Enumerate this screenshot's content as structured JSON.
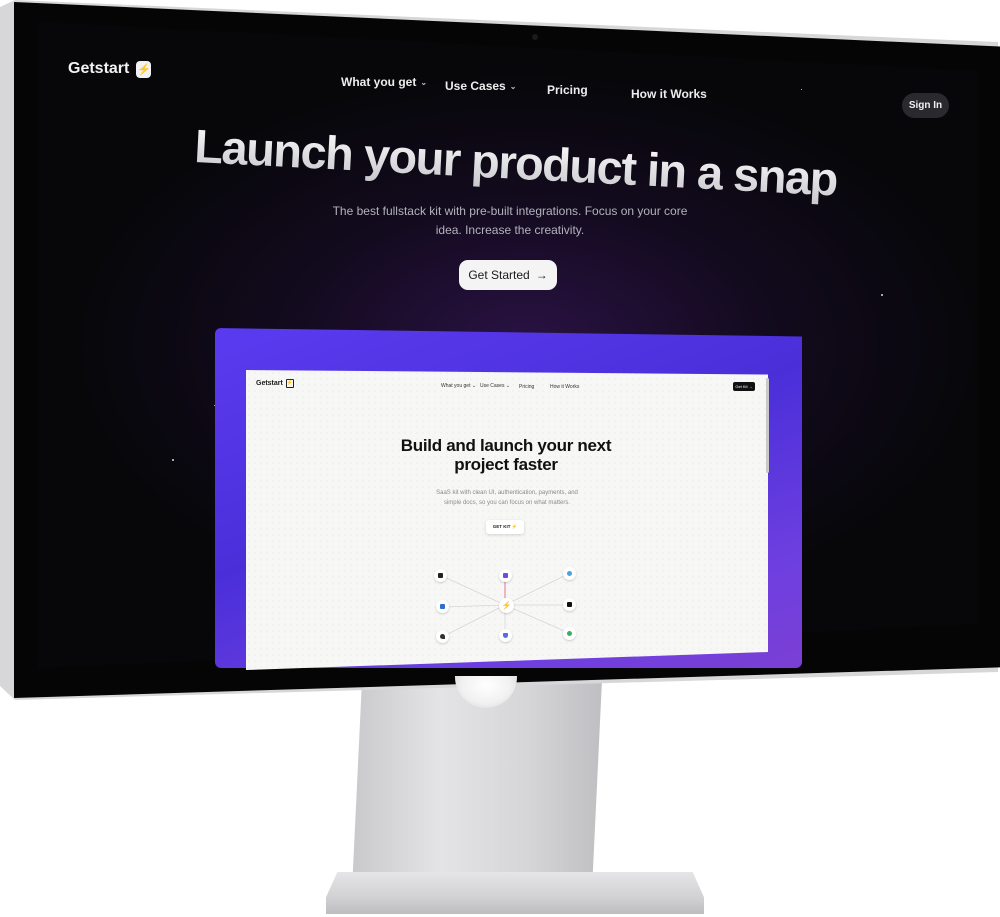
{
  "app": {
    "logo_text": "Getstart",
    "logo_glyph": "⚡"
  },
  "nav": {
    "items": [
      {
        "label": "What you get",
        "has_menu": true
      },
      {
        "label": "Use Cases",
        "has_menu": true
      },
      {
        "label": "Pricing",
        "has_menu": false
      },
      {
        "label": "How it Works",
        "has_menu": false
      }
    ],
    "chevron_glyph": "⌄",
    "sign_in_label": "Sign In"
  },
  "hero": {
    "headline": "Launch your product in a snap",
    "subline": "The best fullstack kit with pre-built integrations. Focus on your core idea. Increase the creativity.",
    "cta_label": "Get Started",
    "cta_arrow": "→"
  },
  "preview": {
    "logo_text": "Getstart",
    "nav": [
      "What you get ⌄",
      "Use Cases ⌄",
      "Pricing",
      "How it Works"
    ],
    "button_label": "Get Kit →",
    "title": "Build and launch your next project faster",
    "subline": "SaaS kit with clean UI, authentication, payments, and simple docs, so you can focus on what matters.",
    "cta_label": "GET KIT ⚡"
  },
  "colors": {
    "accent_purple": "#5b3bf0",
    "background": "#07070a",
    "cta_bg": "#f4f4f5"
  }
}
